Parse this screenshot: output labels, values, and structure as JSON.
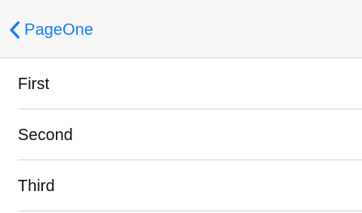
{
  "navigation_bar": {
    "back_label": "PageOne",
    "back_icon": "chevron-left-icon",
    "accent_color": "#1a7cf5"
  },
  "list": {
    "items": [
      {
        "label": "First"
      },
      {
        "label": "Second"
      },
      {
        "label": "Third"
      }
    ]
  }
}
